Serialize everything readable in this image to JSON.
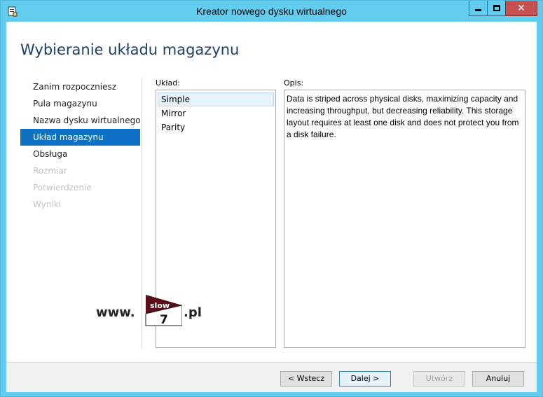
{
  "window": {
    "title": "Kreator nowego dysku wirtualnego",
    "controls": {
      "close_glyph": "✕"
    }
  },
  "page": {
    "title": "Wybieranie układu magazynu"
  },
  "steps": [
    {
      "label": "Zanim rozpoczniesz",
      "state": "visited"
    },
    {
      "label": "Pula magazynu",
      "state": "visited"
    },
    {
      "label": "Nazwa dysku wirtualnego",
      "state": "visited"
    },
    {
      "label": "Układ magazynu",
      "state": "active"
    },
    {
      "label": "Obsługa",
      "state": "next"
    },
    {
      "label": "Rozmiar",
      "state": "disabled"
    },
    {
      "label": "Potwierdzenie",
      "state": "disabled"
    },
    {
      "label": "Wyniki",
      "state": "disabled"
    }
  ],
  "layout": {
    "label": "Układ:",
    "options": [
      "Simple",
      "Mirror",
      "Parity"
    ],
    "selected": "Simple"
  },
  "description": {
    "label": "Opis:",
    "text": "Data is striped across physical disks, maximizing capacity and increasing throughput, but decreasing reliability. This storage layout requires at least one disk and does not protect you from a disk failure."
  },
  "watermark": {
    "prefix": "www.",
    "logo_top": "slow",
    "logo_num": "7",
    "suffix": ".pl"
  },
  "buttons": {
    "back": "< Wstecz",
    "next": "Dalej >",
    "create": "Utwórz",
    "cancel": "Anuluj"
  },
  "colors": {
    "frame": "#63cdef",
    "active_step": "#0d72c6",
    "title_text": "#1e3f66"
  }
}
